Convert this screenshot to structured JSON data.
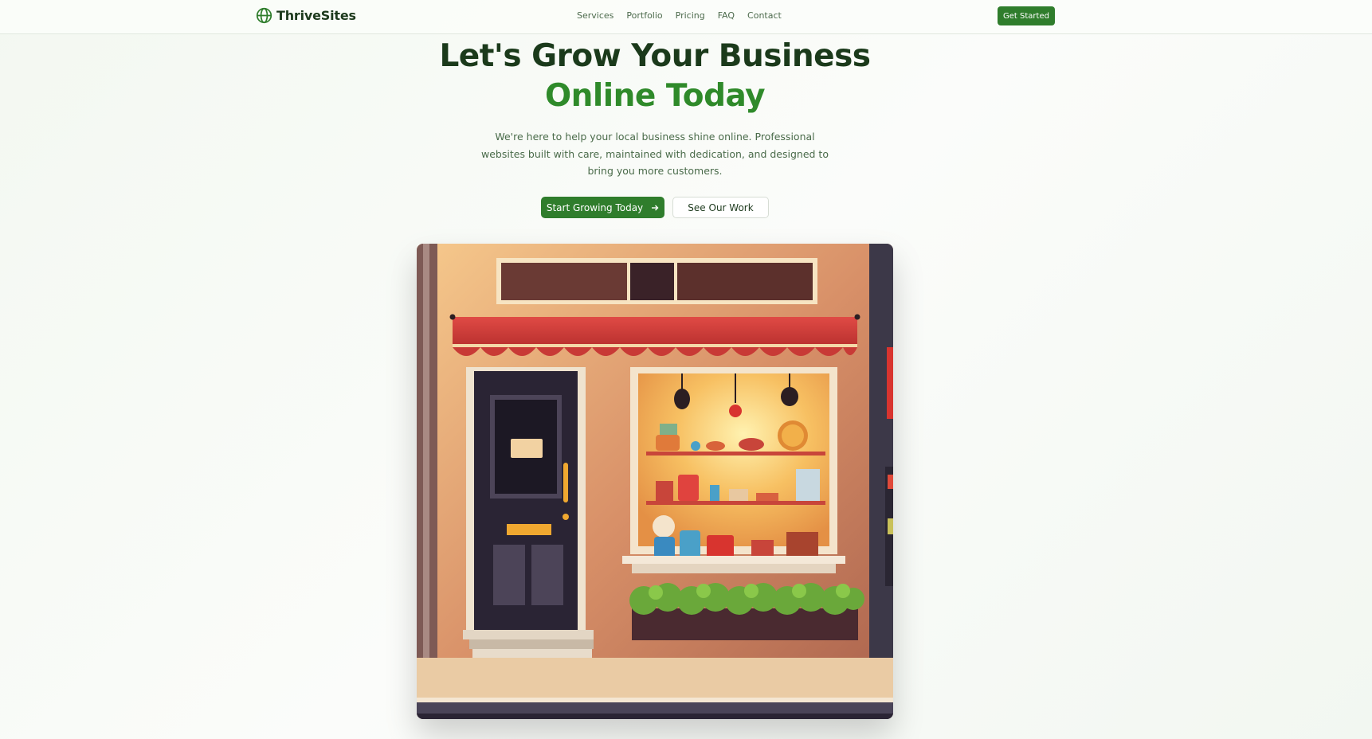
{
  "nav": {
    "brand": "ThriveSites",
    "brand_icon": "globe-icon",
    "links": [
      "Services",
      "Portfolio",
      "Pricing",
      "FAQ",
      "Contact"
    ],
    "cta": "Get Started"
  },
  "hero": {
    "title_line1": "Let's Grow Your Business",
    "title_line2": "Online Today",
    "subtitle": "We're here to help your local business shine online. Professional websites built with care, maintained with dedication, and designed to bring you more customers.",
    "primary_button": "Start Growing Today",
    "primary_button_icon": "arrow-right-icon",
    "secondary_button": "See Our Work",
    "image": "storefront-illustration"
  },
  "colors": {
    "brand_green": "#2f7d2c",
    "accent_green": "#2f8a2a",
    "heading": "#1b3a1b",
    "text": "#4a6b4a"
  }
}
